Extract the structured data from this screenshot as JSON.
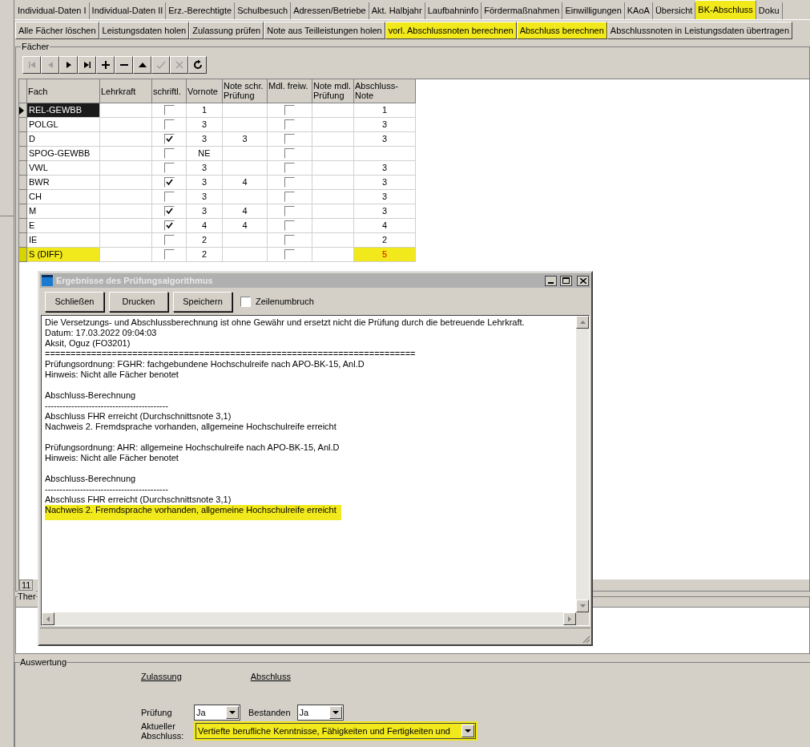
{
  "tabs": [
    {
      "label": "Individual-Daten I",
      "selected": false,
      "highlighted": false
    },
    {
      "label": "Individual-Daten II",
      "selected": false,
      "highlighted": false
    },
    {
      "label": "Erz.-Berechtigte",
      "selected": false,
      "highlighted": false
    },
    {
      "label": "Schulbesuch",
      "selected": false,
      "highlighted": false
    },
    {
      "label": "Adressen/Betriebe",
      "selected": false,
      "highlighted": false
    },
    {
      "label": "Akt. Halbjahr",
      "selected": false,
      "highlighted": false
    },
    {
      "label": "Laufbahninfo",
      "selected": false,
      "highlighted": false
    },
    {
      "label": "Fördermaßnahmen",
      "selected": false,
      "highlighted": false
    },
    {
      "label": "Einwilligungen",
      "selected": false,
      "highlighted": false
    },
    {
      "label": "KAoA",
      "selected": false,
      "highlighted": false
    },
    {
      "label": "Übersicht",
      "selected": false,
      "highlighted": false
    },
    {
      "label": "BK-Abschluss",
      "selected": true,
      "highlighted": true
    },
    {
      "label": "Doku",
      "selected": false,
      "highlighted": false
    }
  ],
  "actions": [
    {
      "label": "Alle Fächer löschen",
      "highlighted": false
    },
    {
      "label": "Leistungsdaten holen",
      "highlighted": false
    },
    {
      "label": "Zulassung prüfen",
      "highlighted": false
    },
    {
      "label": "Note aus Teilleistungen holen",
      "highlighted": false
    },
    {
      "label": "vorl. Abschlussnoten berechnen",
      "highlighted": true
    },
    {
      "label": "Abschluss berechnen",
      "highlighted": true
    },
    {
      "label": "Abschlussnoten in Leistungsdaten übertragen",
      "highlighted": false
    }
  ],
  "faecher": {
    "title": "Fächer",
    "toolbar": [
      {
        "kind": "first",
        "disabled": true
      },
      {
        "kind": "prev",
        "disabled": true
      },
      {
        "kind": "next",
        "disabled": false
      },
      {
        "kind": "last",
        "disabled": false
      },
      {
        "kind": "add",
        "disabled": false
      },
      {
        "kind": "remove",
        "disabled": false
      },
      {
        "kind": "up",
        "disabled": false
      },
      {
        "kind": "check",
        "disabled": true
      },
      {
        "kind": "cancel",
        "disabled": true
      },
      {
        "kind": "refresh",
        "disabled": false
      }
    ],
    "columns": [
      "Fach",
      "Lehrkraft",
      "schriftl.",
      "Vornote",
      "Note schr. Prüfung",
      "Mdl. freiw.",
      "Note mdl. Prüfung",
      "Abschluss-Note"
    ],
    "rows": [
      {
        "fach": "REL-GEWBB",
        "schriftlich": false,
        "vornote": "1",
        "mdl_freiw": false,
        "abschluss": "1",
        "selected": true,
        "highlighted": false,
        "alert": false
      },
      {
        "fach": "POLGL",
        "schriftlich": false,
        "vornote": "3",
        "mdl_freiw": false,
        "abschluss": "3",
        "selected": false,
        "highlighted": false,
        "alert": false
      },
      {
        "fach": "D",
        "schriftlich": true,
        "vornote": "3",
        "note_schr": "3",
        "mdl_freiw": false,
        "abschluss": "3",
        "selected": false,
        "highlighted": false,
        "alert": false
      },
      {
        "fach": "SPOG-GEWBB",
        "schriftlich": false,
        "vornote": "NE",
        "mdl_freiw": false,
        "selected": false,
        "highlighted": false
      },
      {
        "fach": "VWL",
        "schriftlich": false,
        "vornote": "3",
        "mdl_freiw": false,
        "abschluss": "3",
        "selected": false,
        "highlighted": false,
        "alert": false
      },
      {
        "fach": "BWR",
        "schriftlich": true,
        "vornote": "3",
        "note_schr": "4",
        "mdl_freiw": false,
        "abschluss": "3",
        "selected": false,
        "highlighted": false,
        "alert": false
      },
      {
        "fach": "CH",
        "schriftlich": false,
        "vornote": "3",
        "mdl_freiw": false,
        "abschluss": "3",
        "selected": false,
        "highlighted": false,
        "alert": false
      },
      {
        "fach": "M",
        "schriftlich": true,
        "vornote": "3",
        "note_schr": "4",
        "mdl_freiw": false,
        "abschluss": "3",
        "selected": false,
        "highlighted": false,
        "alert": false
      },
      {
        "fach": "E",
        "schriftlich": true,
        "vornote": "4",
        "note_schr": "4",
        "mdl_freiw": false,
        "abschluss": "4",
        "selected": false,
        "highlighted": false,
        "alert": false
      },
      {
        "fach": "IE",
        "schriftlich": false,
        "vornote": "2",
        "mdl_freiw": false,
        "abschluss": "2",
        "selected": false,
        "highlighted": false,
        "alert": false
      },
      {
        "fach": "S (DIFF)",
        "schriftlich": false,
        "vornote": "2",
        "mdl_freiw": false,
        "abschluss": "5",
        "selected": false,
        "highlighted": true,
        "alert": true
      }
    ],
    "count": "11"
  },
  "notes_group": {
    "title": "Ther"
  },
  "dialog": {
    "title": "Ergebnisse des Prüfungsalgorithmus",
    "buttons": [
      "Schließen",
      "Drucken",
      "Speichern"
    ],
    "wrap": {
      "label": "Zeilenumbruch",
      "checked": false
    },
    "paragraphs": [
      [
        {
          "text": "Die Versetzungs- und Abschlussberechnung ist ohne Gewähr und ersetzt nicht die Prüfung durch die betreuende Lehrkraft.",
          "highlighted": false
        },
        {
          "text": "Datum: 17.03.2022 09:04:03",
          "highlighted": false
        },
        {
          "text": "Aksit, Oguz (FO3201)",
          "highlighted": false
        },
        {
          "text": "========================================================================",
          "highlighted": false
        },
        {
          "text": "Prüfungsordnung: FGHR: fachgebundene Hochschulreife nach APO-BK-15, Anl.D",
          "highlighted": false
        },
        {
          "text": "Hinweis: Nicht alle Fächer benotet",
          "highlighted": false
        }
      ],
      [
        {
          "text": "Abschluss-Berechnung",
          "highlighted": false
        },
        {
          "text": "------------------------------------------",
          "highlighted": false
        },
        {
          "text": "Abschluss FHR erreicht (Durchschnittsnote 3,1)",
          "highlighted": false
        },
        {
          "text": "Nachweis 2. Fremdsprache vorhanden, allgemeine Hochschulreife erreicht",
          "highlighted": false
        }
      ],
      [
        {
          "text": "Prüfungsordnung: AHR: allgemeine Hochschulreife nach APO-BK-15, Anl.D",
          "highlighted": false
        },
        {
          "text": "Hinweis: Nicht alle Fächer benotet",
          "highlighted": false
        }
      ],
      [
        {
          "text": "Abschluss-Berechnung",
          "highlighted": false
        },
        {
          "text": "------------------------------------------",
          "highlighted": false
        },
        {
          "text": "Abschluss FHR erreicht (Durchschnittsnote 3,1)",
          "highlighted": false
        },
        {
          "text": "Nachweis 2. Fremdsprache vorhanden, allgemeine Hochschulreife erreicht",
          "highlighted": true
        }
      ]
    ]
  },
  "auswertung": {
    "title": "Auswertung",
    "heading_zulassung": "Zulassung",
    "heading_abschluss": "Abschluss",
    "pruefung": {
      "label": "Prüfung",
      "value": "Ja"
    },
    "bestanden": {
      "label": "Bestanden",
      "value": "Ja"
    },
    "aktuell": {
      "label": "Aktueller Abschluss:",
      "value": "Vertiefte berufliche Kenntnisse, Fähigkeiten und Fertigkeiten und",
      "highlighted": true
    }
  }
}
